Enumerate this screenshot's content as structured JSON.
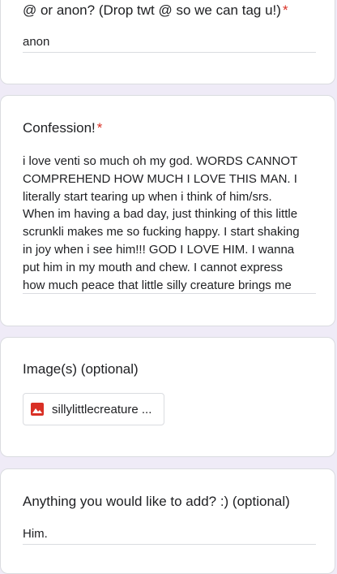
{
  "questions": [
    {
      "title": "@ or anon? (Drop twt @ so we can tag u!)",
      "required_mark": "*",
      "answer": "anon"
    },
    {
      "title": "Confession!",
      "required_mark": "*",
      "answer": "i love venti so much oh my god. WORDS CANNOT\nCOMPREHEND HOW MUCH I LOVE THIS MAN. I\nliterally start tearing up when i think of him/srs.\nWhen im having a bad day, just thinking of this little\nscrunkli makes me so fucking happy. I start shaking\nin joy when i see him!!! GOD I LOVE HIM. I wanna\nput him in my mouth and chew. I cannot express\nhow much peace that little silly creature brings me"
    },
    {
      "title": "Image(s) (optional)",
      "file": {
        "name": "sillylittlecreature ...",
        "icon": "image-file-icon",
        "icon_color": "#d93025"
      }
    },
    {
      "title": "Anything you would like to add? :) (optional)",
      "answer": "Him."
    }
  ],
  "colors": {
    "background": "#efebf7",
    "required": "#d93025",
    "underline": "#dadce0"
  }
}
